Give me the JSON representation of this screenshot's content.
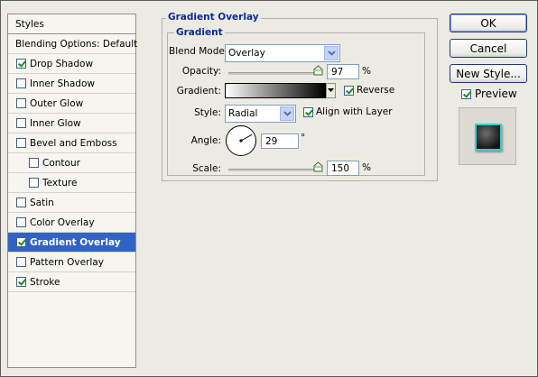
{
  "styles_panel": {
    "header": "Styles",
    "items": [
      {
        "label": "Blending Options: Default",
        "checkbox": false,
        "checked": false,
        "sub": false,
        "selected": false,
        "is_section": true
      },
      {
        "label": "Drop Shadow",
        "checkbox": true,
        "checked": true,
        "sub": false,
        "selected": false
      },
      {
        "label": "Inner Shadow",
        "checkbox": true,
        "checked": false,
        "sub": false,
        "selected": false
      },
      {
        "label": "Outer Glow",
        "checkbox": true,
        "checked": false,
        "sub": false,
        "selected": false
      },
      {
        "label": "Inner Glow",
        "checkbox": true,
        "checked": false,
        "sub": false,
        "selected": false
      },
      {
        "label": "Bevel and Emboss",
        "checkbox": true,
        "checked": false,
        "sub": false,
        "selected": false
      },
      {
        "label": "Contour",
        "checkbox": true,
        "checked": false,
        "sub": true,
        "selected": false
      },
      {
        "label": "Texture",
        "checkbox": true,
        "checked": false,
        "sub": true,
        "selected": false
      },
      {
        "label": "Satin",
        "checkbox": true,
        "checked": false,
        "sub": false,
        "selected": false
      },
      {
        "label": "Color Overlay",
        "checkbox": true,
        "checked": false,
        "sub": false,
        "selected": false
      },
      {
        "label": "Gradient Overlay",
        "checkbox": true,
        "checked": true,
        "sub": false,
        "selected": true
      },
      {
        "label": "Pattern Overlay",
        "checkbox": true,
        "checked": false,
        "sub": false,
        "selected": false
      },
      {
        "label": "Stroke",
        "checkbox": true,
        "checked": true,
        "sub": false,
        "selected": false
      }
    ]
  },
  "gradient_overlay": {
    "title": "Gradient Overlay",
    "group_title": "Gradient",
    "blend_mode_label": "Blend Mode:",
    "blend_mode_value": "Overlay",
    "opacity_label": "Opacity:",
    "opacity_value": "97",
    "opacity_percent": 97,
    "opacity_unit": "%",
    "gradient_label": "Gradient:",
    "reverse_label": "Reverse",
    "reverse_checked": true,
    "style_label": "Style:",
    "style_value": "Radial",
    "align_label": "Align with Layer",
    "align_checked": true,
    "angle_label": "Angle:",
    "angle_value": "29",
    "angle_degrees": 29,
    "angle_unit": "°",
    "scale_label": "Scale:",
    "scale_value": "150",
    "scale_fraction": 0.97,
    "scale_unit": "%"
  },
  "buttons": {
    "ok": "OK",
    "cancel": "Cancel",
    "new_style": "New Style...",
    "preview_label": "Preview",
    "preview_checked": true
  },
  "colors": {
    "selection": "#3163c5",
    "group_title": "#0a2a9a",
    "preview_stroke": "#2fd0cf"
  }
}
